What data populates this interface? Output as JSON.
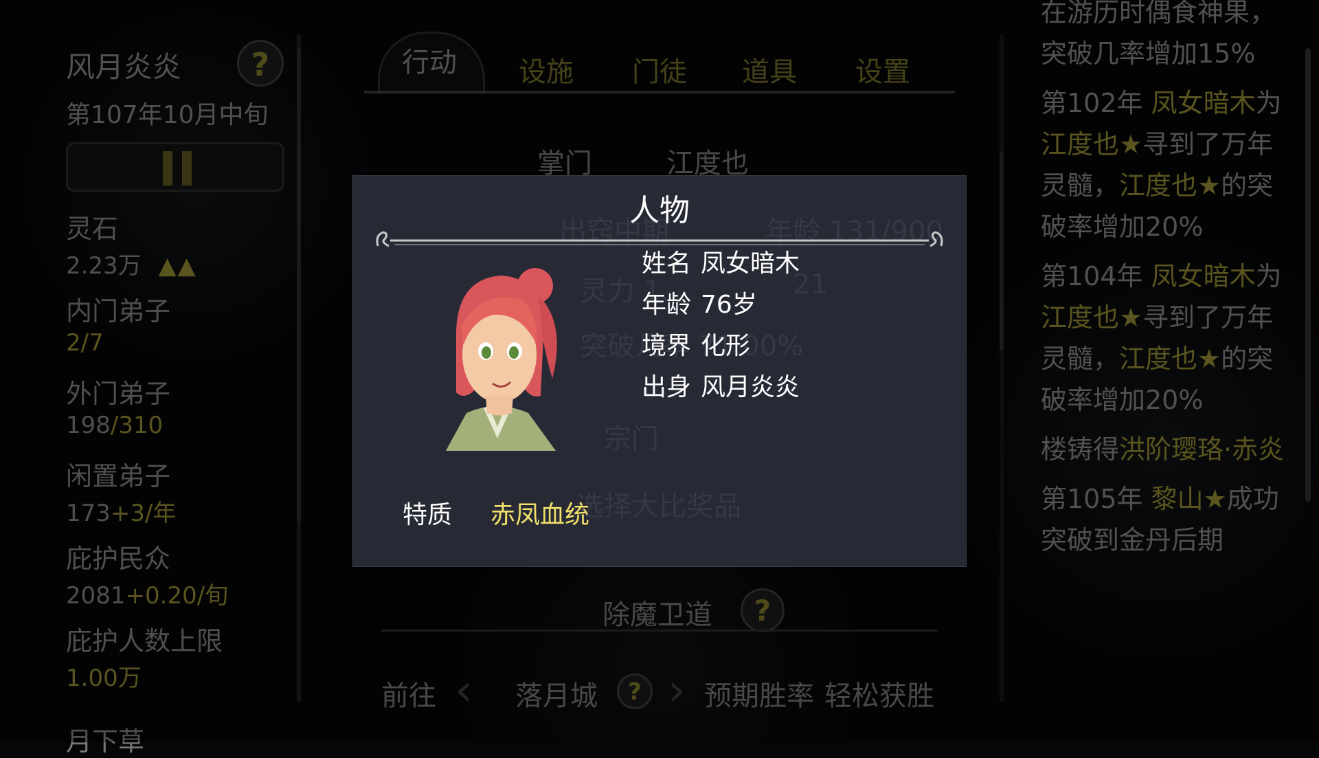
{
  "sidebar": {
    "sect_name": "风月炎炎",
    "date": "第107年10月中旬",
    "stats": [
      {
        "label": "灵石",
        "value": "2.23万",
        "extra": "▲▲"
      },
      {
        "label": "内门弟子",
        "value": "2/7"
      },
      {
        "label": "外门弟子",
        "value": "198",
        "value2": "/310"
      },
      {
        "label": "闲置弟子",
        "value": "173",
        "value2": "+3/年"
      },
      {
        "label": "庇护民众",
        "value": "2081",
        "value2": "+0.20/旬"
      },
      {
        "label": "庇护人数上限",
        "value": "1.00万"
      },
      {
        "label": "月下草"
      }
    ]
  },
  "tabs": [
    "行动",
    "设施",
    "门徒",
    "道具",
    "设置"
  ],
  "main": {
    "leader_label": "掌门",
    "leader_name": "江度也",
    "faded_rows": [
      "出窍中期",
      "年龄 131/900",
      "灵力 1.",
      "21",
      "突破几率 71.00%",
      "宗门",
      "选择大比奖品"
    ],
    "demon_section": "除魔卫道",
    "goto_label": "前往",
    "city": "落月城",
    "winrate_label": "预期胜率",
    "winrate_value": "轻松获胜"
  },
  "modal": {
    "title": "人物",
    "name_label": "姓名",
    "name_value": "凤女暗木",
    "age_label": "年龄",
    "age_value": "76岁",
    "realm_label": "境界",
    "realm_value": "化形",
    "origin_label": "出身",
    "origin_value": "风月炎炎",
    "trait_label": "特质",
    "trait_value": "赤凤血统"
  },
  "log": [
    {
      "parts": [
        {
          "t": "在游历时偶食神果，突破几率增加15%",
          "c": "n"
        }
      ]
    },
    {
      "parts": [
        {
          "t": "第102年 ",
          "c": "n"
        },
        {
          "t": "凤女暗木",
          "c": "g"
        },
        {
          "t": "为",
          "c": "n"
        },
        {
          "t": "江度也★",
          "c": "g"
        },
        {
          "t": "寻到了万年灵髓，",
          "c": "n"
        },
        {
          "t": "江度也★",
          "c": "g"
        },
        {
          "t": "的突破率增加20%",
          "c": "n"
        }
      ]
    },
    {
      "parts": [
        {
          "t": "第104年 ",
          "c": "n"
        },
        {
          "t": "凤女暗木",
          "c": "g"
        },
        {
          "t": "为",
          "c": "n"
        },
        {
          "t": "江度也★",
          "c": "g"
        },
        {
          "t": "寻到了万年灵髓，",
          "c": "n"
        },
        {
          "t": "江度也★",
          "c": "g"
        },
        {
          "t": "的突破率增加20%",
          "c": "n"
        }
      ]
    },
    {
      "parts": [
        {
          "t": "楼铸得",
          "c": "n"
        },
        {
          "t": "洪阶璎珞·赤炎",
          "c": "g"
        }
      ]
    },
    {
      "parts": [
        {
          "t": "第105年 ",
          "c": "n"
        },
        {
          "t": "黎山★",
          "c": "g"
        },
        {
          "t": "成功突破到金丹后期",
          "c": "n"
        }
      ]
    }
  ],
  "colors": {
    "gold": "#8a8230",
    "trait": "#f1e06a",
    "modal_bg": "#272a35",
    "winrate": "#2f7d8a"
  }
}
